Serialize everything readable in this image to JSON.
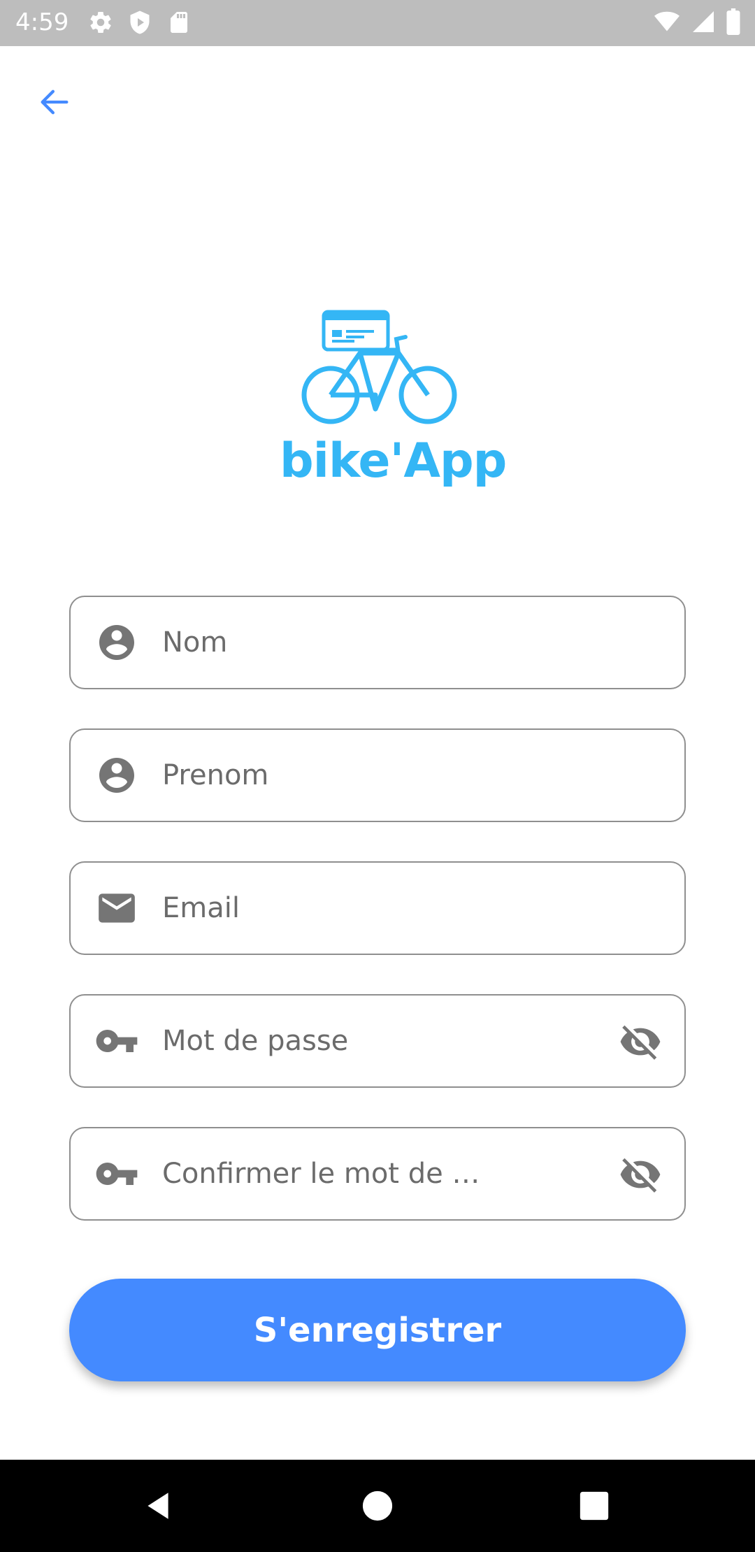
{
  "status_bar": {
    "time": "4:59",
    "icons_left": [
      "gear-icon",
      "shield-icon",
      "sd-card-icon"
    ],
    "icons_right": [
      "wifi-icon",
      "signal-icon",
      "battery-icon"
    ]
  },
  "header": {
    "back_icon": "arrow-left-icon"
  },
  "logo": {
    "text": "bike'App",
    "color": "#34b6f5"
  },
  "form": {
    "fields": [
      {
        "placeholder": "Nom",
        "icon": "person-icon",
        "value": ""
      },
      {
        "placeholder": "Prenom",
        "icon": "person-icon",
        "value": ""
      },
      {
        "placeholder": "Email",
        "icon": "mail-icon",
        "value": ""
      },
      {
        "placeholder": "Mot de passe",
        "icon": "key-icon",
        "value": "",
        "toggle_icon": "eye-off-icon"
      },
      {
        "placeholder": "Confirmer le mot de …",
        "icon": "key-icon",
        "value": "",
        "toggle_icon": "eye-off-icon"
      }
    ],
    "submit_label": "S'enregistrer"
  },
  "colors": {
    "accent": "#448aff",
    "logo": "#34b6f5",
    "icon_gray": "#757575"
  },
  "nav_bar": {
    "buttons": [
      "back-triangle-icon",
      "home-circle-icon",
      "recents-square-icon"
    ]
  }
}
